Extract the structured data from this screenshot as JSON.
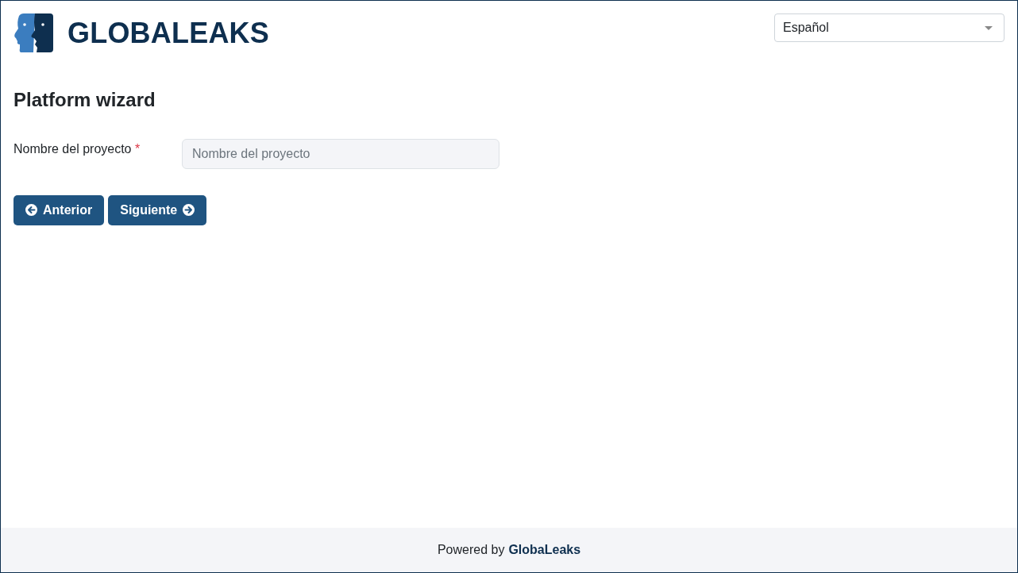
{
  "header": {
    "logo_text": "GLOBALEAKS",
    "language_select": {
      "value": "Español"
    }
  },
  "wizard": {
    "title": "Platform wizard",
    "fields": [
      {
        "label": "Nombre del proyecto",
        "required_mark": "*",
        "placeholder": "Nombre del proyecto"
      }
    ],
    "buttons": [
      {
        "label": "Anterior",
        "kind": "previous"
      },
      {
        "label": "Siguiente",
        "kind": "next"
      }
    ]
  },
  "footer": {
    "text": "Powered by",
    "link": "GlobaLeaks"
  }
}
